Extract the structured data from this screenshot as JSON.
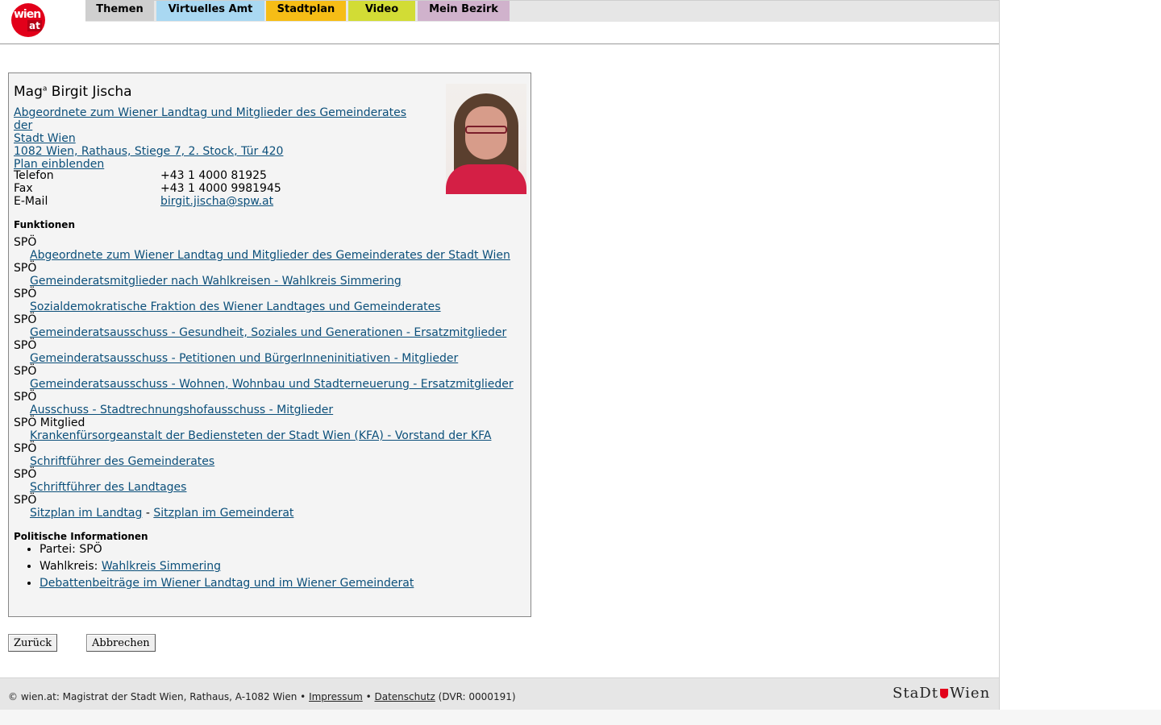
{
  "logo": {
    "top": "wien",
    "bottom": "at"
  },
  "nav": {
    "tabs": [
      {
        "label": "Themen",
        "color": "#cfcfcf"
      },
      {
        "label": "Virtuelles Amt",
        "color": "#a9d8f2"
      },
      {
        "label": "Stadtplan",
        "color": "#f6bd16"
      },
      {
        "label": "Video",
        "color": "#d2dc35"
      },
      {
        "label": "Mein Bezirk",
        "color": "#d0b2cc"
      }
    ]
  },
  "person": {
    "name_prefix": "Mag",
    "name_sup": "a",
    "name": " Birgit Jischa",
    "role_line1": "Abgeordnete zum Wiener Landtag und Mitglieder des Gemeinderates der",
    "role_line2": "Stadt Wien",
    "address": "1082 Wien, Rathaus, Stiege 7, 2. Stock, Tür 420",
    "plan_link": "Plan einblenden",
    "contact": [
      {
        "label": "Telefon",
        "value": "+43 1 4000 81925",
        "link": false
      },
      {
        "label": "Fax",
        "value": "+43 1 4000 9981945",
        "link": false
      },
      {
        "label": "E-Mail",
        "value": "birgit.jischa@spw.at",
        "link": true
      }
    ]
  },
  "functions": {
    "title": "Funktionen",
    "items": [
      {
        "party": "SPÖ",
        "link": "Abgeordnete zum Wiener Landtag und Mitglieder des Gemeinderates der Stadt Wien"
      },
      {
        "party": "SPÖ",
        "link": "Gemeinderatsmitglieder nach Wahlkreisen - Wahlkreis Simmering"
      },
      {
        "party": "SPÖ",
        "link": "Sozialdemokratische Fraktion des Wiener Landtages und Gemeinderates"
      },
      {
        "party": "SPÖ",
        "link": "Gemeinderatsausschuss - Gesundheit, Soziales und Generationen - Ersatzmitglieder"
      },
      {
        "party": "SPÖ",
        "link": "Gemeinderatsausschuss - Petitionen und BürgerInneninitiativen - Mitglieder"
      },
      {
        "party": "SPÖ",
        "link": "Gemeinderatsausschuss - Wohnen, Wohnbau und Stadterneuerung - Ersatzmitglieder"
      },
      {
        "party": "SPÖ",
        "link": "Ausschuss - Stadtrechnungshofausschuss - Mitglieder"
      },
      {
        "party": "SPÖ Mitglied",
        "link": "Krankenfürsorgeanstalt der Bediensteten der Stadt Wien (KFA) - Vorstand der KFA"
      },
      {
        "party": "SPÖ",
        "link": "Schriftführer des Gemeinderates"
      },
      {
        "party": "SPÖ",
        "link": "Schriftführer des Landtages"
      }
    ],
    "last_party": "SPÖ",
    "seat_landtag": "Sitzplan im Landtag",
    "seat_sep": " - ",
    "seat_gemeinderat": "Sitzplan im Gemeinderat"
  },
  "political": {
    "title": "Politische Informationen",
    "party_label": "Partei: ",
    "party_value": "SPÖ",
    "district_label": "Wahlkreis: ",
    "district_link": "Wahlkreis Simmering",
    "debates_link": "Debattenbeiträge im Wiener Landtag und im Wiener Gemeinderat"
  },
  "buttons": {
    "back": "Zurück",
    "cancel": "Abbrechen"
  },
  "footer": {
    "copyright": "© wien.at: Magistrat der Stadt Wien, Rathaus, A-1082 Wien • ",
    "impressum": "Impressum",
    "sep": " • ",
    "datenschutz": "Datenschutz",
    "dvr": " (DVR: 0000191)",
    "stadt_logo_left": "StaDt",
    "stadt_logo_right": "Wien"
  }
}
